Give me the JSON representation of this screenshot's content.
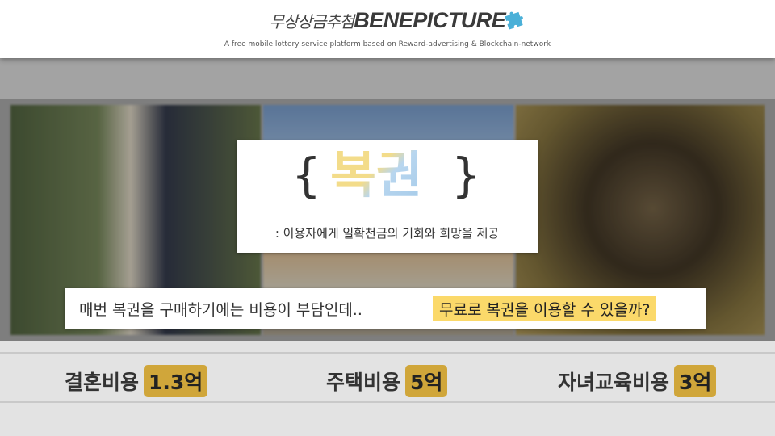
{
  "header": {
    "brand_ko": "무상상금추첨",
    "brand_en": "BENEPICTURE",
    "tagline": "A free mobile lottery service platform based on Reward-advertising & Blockchain-network",
    "logo_icon": "puzzle-piece-icon",
    "logo_color": "#4ab0d8"
  },
  "lottery_card": {
    "brace_open": "{",
    "word": "복권",
    "brace_close": "}",
    "description": ": 이용자에게 일확천금의 기회와 희망을 제공"
  },
  "question": {
    "text": "매번 복권을 구매하기에는 비용이 부담인데..",
    "highlight": "무료로 복권을 이용할 수 있을까?",
    "highlight_color": "#fbd96a"
  },
  "costs": [
    {
      "label": "결혼비용",
      "amount": "1.3억"
    },
    {
      "label": "주택비용",
      "amount": "5억"
    },
    {
      "label": "자녀교육비용",
      "amount": "3억"
    }
  ],
  "colors": {
    "amount_badge": "#d0a63a",
    "lotto_gradient_warm": "#f3dc8a",
    "lotto_gradient_cool": "#a6cbe9"
  }
}
